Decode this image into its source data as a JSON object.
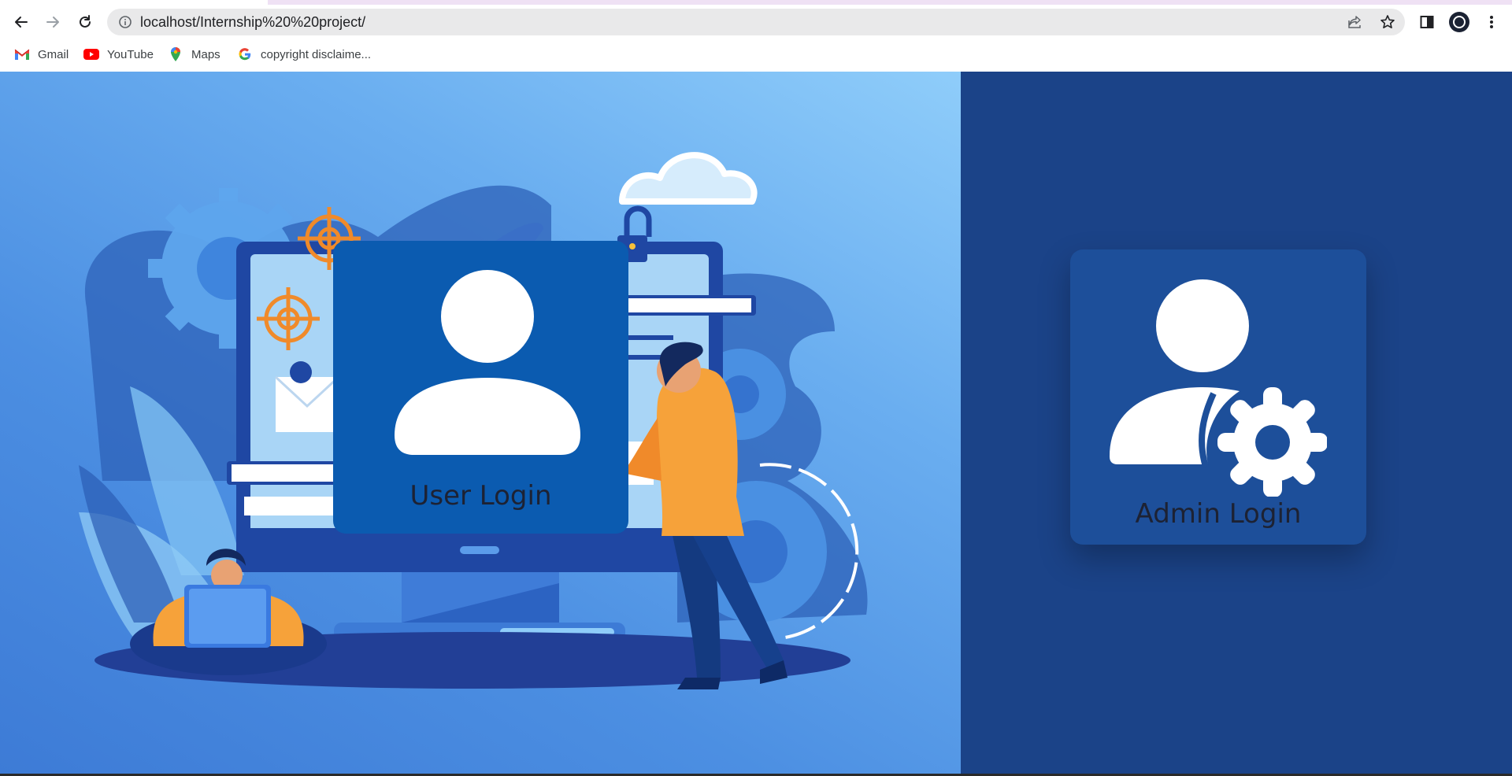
{
  "browser": {
    "url": "localhost/Internship%20%20project/",
    "bookmarks": [
      {
        "label": "Gmail",
        "icon": "gmail-icon"
      },
      {
        "label": "YouTube",
        "icon": "youtube-icon"
      },
      {
        "label": "Maps",
        "icon": "maps-icon"
      },
      {
        "label": "copyright disclaime...",
        "icon": "google-icon"
      }
    ]
  },
  "main": {
    "user_card": {
      "label": "User Login",
      "icon": "user-icon"
    },
    "admin_card": {
      "label": "Admin Login",
      "icon": "user-gear-icon"
    }
  },
  "colors": {
    "hero_light": "#8fcdfa",
    "hero_dark": "#3d7bd6",
    "side_panel": "#1b4388",
    "user_card": "#0b5bb0",
    "admin_card": "#1d4f9a",
    "accent_orange": "#f6a23a"
  }
}
